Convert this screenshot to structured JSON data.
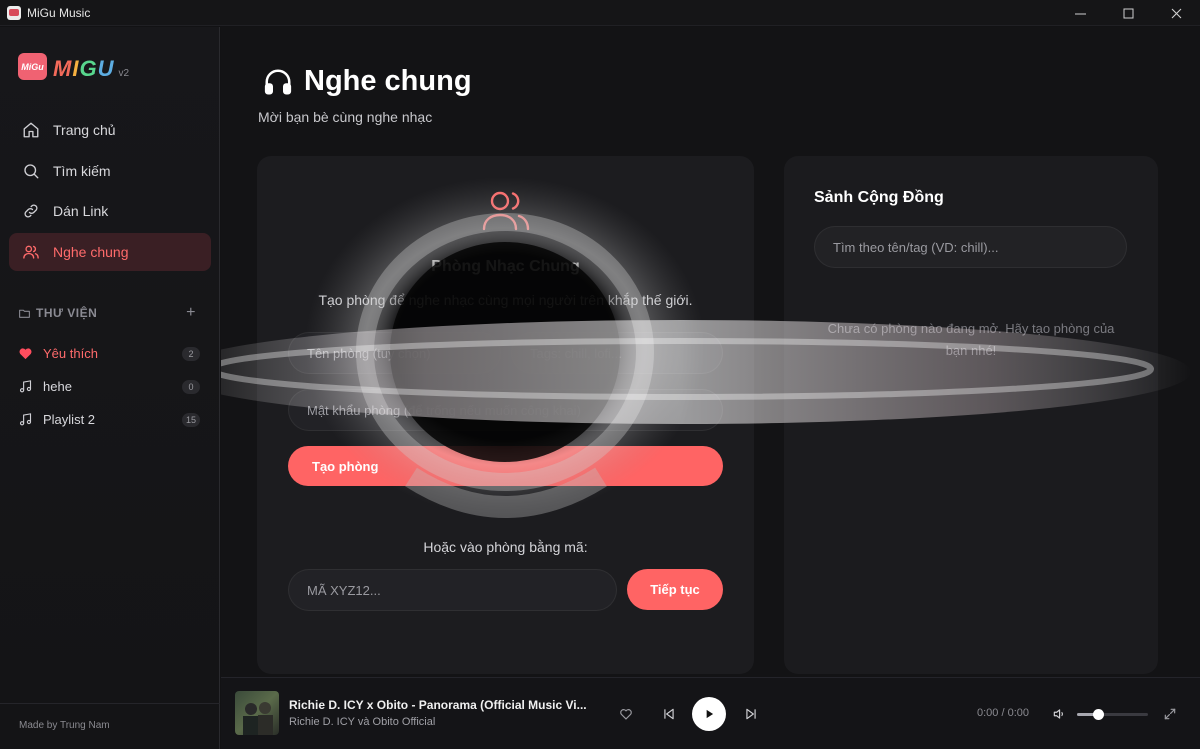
{
  "window": {
    "title": "MiGu Music",
    "controls": [
      "minimize",
      "maximize",
      "close"
    ]
  },
  "brand": {
    "badge_text": "MiGu",
    "word": [
      "M",
      "I",
      "G",
      "U"
    ],
    "version": "v2",
    "colors": [
      "#f26a5a",
      "#f5b041",
      "#58d68d",
      "#5dade2"
    ]
  },
  "nav": {
    "items": [
      {
        "label": "Trang chủ",
        "icon": "home-icon",
        "active": false
      },
      {
        "label": "Tìm kiếm",
        "icon": "search-icon",
        "active": false
      },
      {
        "label": "Dán Link",
        "icon": "link-icon",
        "active": false
      },
      {
        "label": "Nghe chung",
        "icon": "users-icon",
        "active": true
      }
    ]
  },
  "library": {
    "heading": "THƯ VIỆN",
    "add_label": "+",
    "items": [
      {
        "label": "Yêu thích",
        "count": "2",
        "icon": "heart-icon"
      },
      {
        "label": "hehe",
        "count": "0",
        "icon": "music-note-icon"
      },
      {
        "label": "Playlist 2",
        "count": "15",
        "icon": "music-note-icon"
      }
    ]
  },
  "footer": {
    "made_by": "Made by Trung Nam"
  },
  "page": {
    "title": "Nghe chung",
    "subtitle": "Mời bạn bè cùng nghe nhạc"
  },
  "room": {
    "title": "Phòng Nhạc Chung",
    "description": "Tạo phòng để nghe nhạc cùng mọi người trên khắp thế giới.",
    "name_placeholder": "Tên phòng (tuỳ chọn)",
    "tags_placeholder": "Tags: chill, lofi...",
    "password_placeholder": "Mật khẩu phòng (để trống nếu muốn công khai)",
    "create_label": "Tạo phòng",
    "join_prompt": "Hoặc vào phòng bằng mã:",
    "code_placeholder": "MÃ XYZ12...",
    "continue_label": "Tiếp tục"
  },
  "lobby": {
    "title": "Sảnh Cộng Đồng",
    "search_placeholder": "Tìm theo tên/tag (VD: chill)...",
    "empty_text": "Chưa có phòng nào đang mở. Hãy tạo phòng của bạn nhé!"
  },
  "player": {
    "track_title": "Richie D. ICY x Obito - Panorama (Official Music Vi...",
    "artist": "Richie D. ICY và Obito Official",
    "time": "0:00 / 0:00",
    "volume_fraction": 0.3,
    "accent": "#ff6464"
  }
}
